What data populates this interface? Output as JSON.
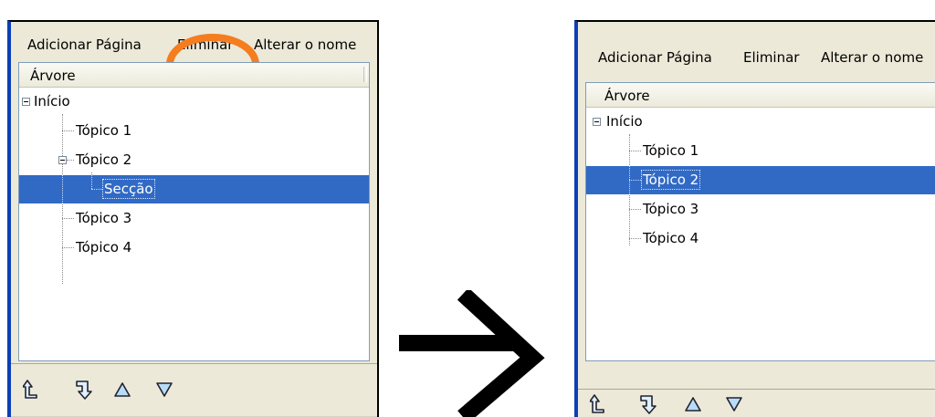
{
  "accent_color": "#316ac5",
  "highlight_color": "#f57c1f",
  "menu": {
    "add_page": "Adicionar Página",
    "delete": "Eliminar",
    "rename": "Alterar o nome"
  },
  "tree_header": "Árvore",
  "before": {
    "nodes": [
      {
        "label": "Início",
        "expanded": true
      },
      {
        "label": "Tópico 1"
      },
      {
        "label": "Tópico 2",
        "expanded": true
      },
      {
        "label": "Secção",
        "selected": true
      },
      {
        "label": "Tópico 3"
      },
      {
        "label": "Tópico 4"
      }
    ]
  },
  "after": {
    "nodes": [
      {
        "label": "Início",
        "expanded": true
      },
      {
        "label": "Tópico 1"
      },
      {
        "label": "Tópico 2",
        "selected": true
      },
      {
        "label": "Tópico 3"
      },
      {
        "label": "Tópico 4"
      }
    ]
  },
  "toolbar_icons": [
    "promote-icon",
    "demote-icon",
    "move-up-icon",
    "move-down-icon"
  ],
  "transition_icon": "arrow-right-icon"
}
